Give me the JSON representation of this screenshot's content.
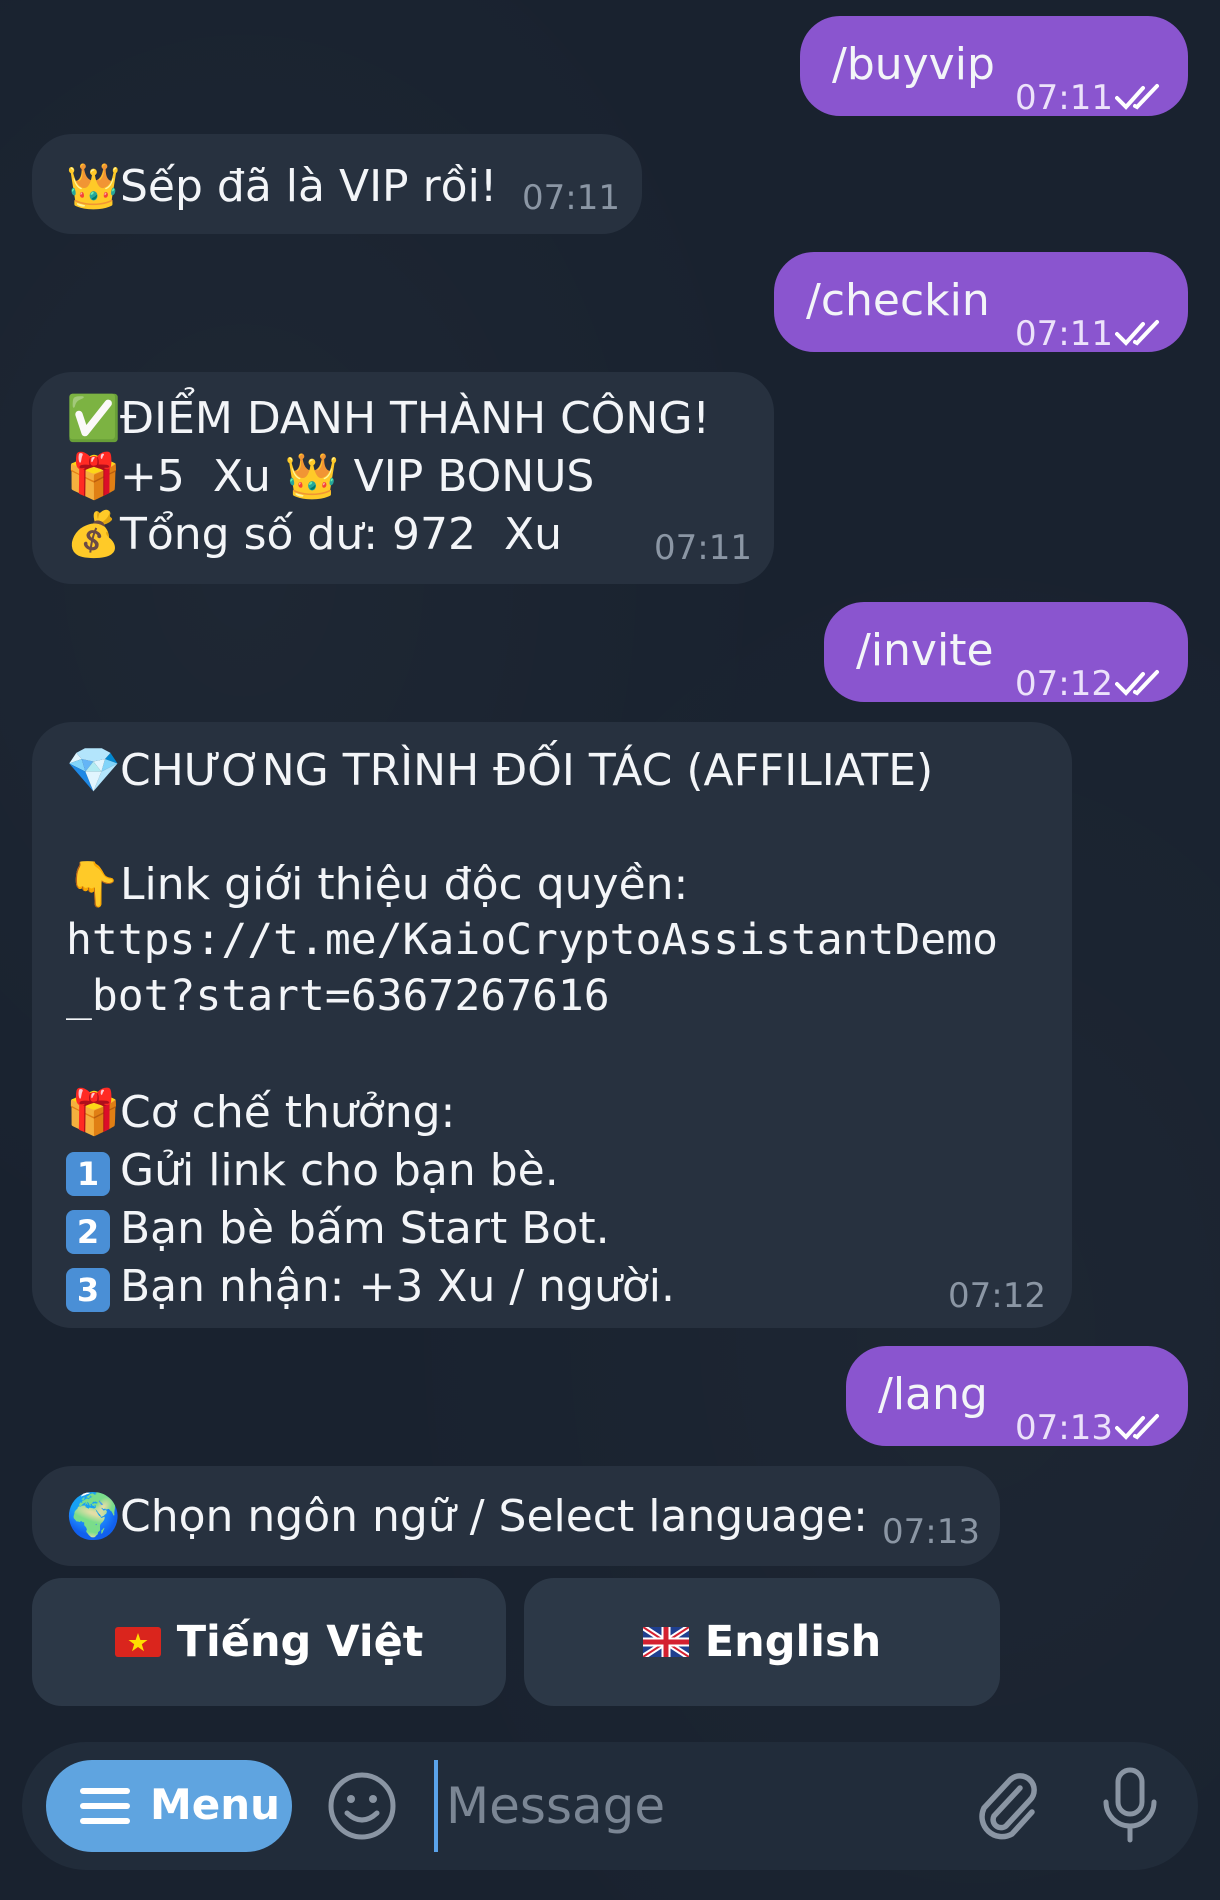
{
  "messages": {
    "buyvip": {
      "text": "/buyvip",
      "time": "07:11"
    },
    "vip_reply": {
      "emoji": "👑",
      "text": "Sếp đã là VIP rồi!",
      "time": "07:11"
    },
    "checkin": {
      "text": "/checkin",
      "time": "07:11"
    },
    "checkin_reply": {
      "line1_emoji": "✅",
      "line1": "ĐIỂM DANH THÀNH CÔNG!",
      "line2_emoji": "🎁",
      "line2a": "+5  Xu ",
      "line2_emoji2": "👑",
      "line2b": " VIP BONUS",
      "line3_emoji": "💰",
      "line3": "Tổng số dư: 972  Xu",
      "time": "07:11"
    },
    "invite": {
      "text": "/invite",
      "time": "07:12"
    },
    "invite_reply": {
      "title_emoji": "💎",
      "title": "CHƯƠNG TRÌNH ĐỐI TÁC (AFFILIATE)",
      "link_emoji": "👇",
      "link_label": "Link giới thiệu độc quyền:",
      "link_line1": "https://t.me/KaioCryptoAssistantDemo",
      "link_line2": "_bot?start=6367267616",
      "reward_emoji": "🎁",
      "reward_label": "Cơ chế thưởng:",
      "steps": [
        {
          "num": "1",
          "text": "Gửi link cho bạn bè."
        },
        {
          "num": "2",
          "text": "Bạn bè bấm Start Bot."
        },
        {
          "num": "3",
          "text": "Bạn nhận: +3 Xu / người."
        }
      ],
      "time": "07:12"
    },
    "lang": {
      "text": "/lang",
      "time": "07:13"
    },
    "lang_reply": {
      "emoji": "🌍",
      "text": "Chọn ngôn ngữ / Select language:",
      "time": "07:13"
    }
  },
  "keyboard": {
    "vietnamese": "Tiếng Việt",
    "english": "English"
  },
  "composer": {
    "menu_label": "Menu",
    "placeholder": "Message"
  },
  "icons": {
    "read_receipt": "double-check-icon",
    "emoji": "smiley-icon",
    "attach": "paperclip-icon",
    "mic": "microphone-icon",
    "menu": "hamburger-icon"
  },
  "colors": {
    "outgoing_bubble": "#8a55cf",
    "incoming_bubble": "#27313f",
    "accent": "#5fa4e0"
  }
}
